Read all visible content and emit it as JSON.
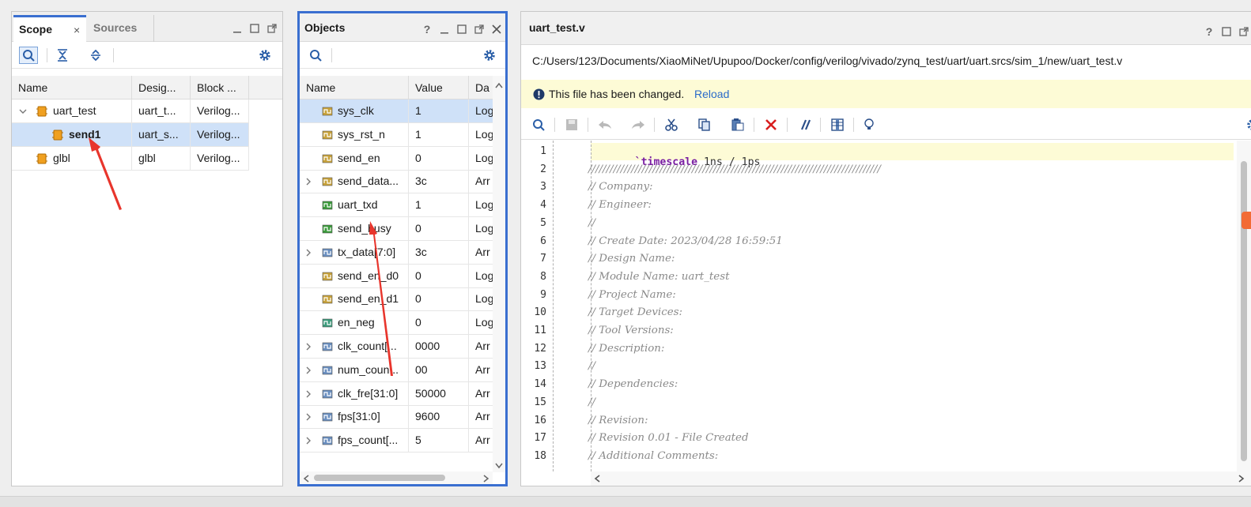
{
  "scope": {
    "tabs": [
      "Scope",
      "Sources"
    ],
    "columns": [
      "Name",
      "Desig...",
      "Block ..."
    ],
    "rows": [
      {
        "name": "uart_test",
        "design": "uart_t...",
        "block": "Verilog..."
      },
      {
        "name": "send1",
        "design": "uart_s...",
        "block": "Verilog..."
      },
      {
        "name": "glbl",
        "design": "glbl",
        "block": "Verilog..."
      }
    ]
  },
  "objects": {
    "title": "Objects",
    "columns": [
      "Name",
      "Value",
      "Da"
    ],
    "rows": [
      {
        "name": "sys_clk",
        "value": "1",
        "type": "Log"
      },
      {
        "name": "sys_rst_n",
        "value": "1",
        "type": "Log"
      },
      {
        "name": "send_en",
        "value": "0",
        "type": "Log"
      },
      {
        "name": "send_data...",
        "value": "3c",
        "type": "Arr"
      },
      {
        "name": "uart_txd",
        "value": "1",
        "type": "Log"
      },
      {
        "name": "send_busy",
        "value": "0",
        "type": "Log"
      },
      {
        "name": "tx_data[7:0]",
        "value": "3c",
        "type": "Arr"
      },
      {
        "name": "send_en_d0",
        "value": "0",
        "type": "Log"
      },
      {
        "name": "send_en_d1",
        "value": "0",
        "type": "Log"
      },
      {
        "name": "en_neg",
        "value": "0",
        "type": "Log"
      },
      {
        "name": "clk_count[...",
        "value": "0000",
        "type": "Arr"
      },
      {
        "name": "num_coun...",
        "value": "00",
        "type": "Arr"
      },
      {
        "name": "clk_fre[31:0]",
        "value": "50000",
        "type": "Arr"
      },
      {
        "name": "fps[31:0]",
        "value": "9600",
        "type": "Arr"
      },
      {
        "name": "fps_count[...",
        "value": "5",
        "type": "Arr"
      }
    ]
  },
  "editor": {
    "title": "uart_test.v",
    "path": "C:/Users/123/Documents/XiaoMiNet/Upupoo/Docker/config/verilog/vivado/zynq_test/uart/uart.srcs/sim_1/new/uart_test.v",
    "notice": "This file has been changed.",
    "reload": "Reload",
    "line_numbers": [
      "1",
      "2",
      "3",
      "4",
      "5",
      "6",
      "7",
      "8",
      "9",
      "10",
      "11",
      "12",
      "13",
      "14",
      "15",
      "16",
      "17",
      "18"
    ],
    "keyword": "`timescale",
    "line1_rest": " 1ns / 1ps",
    "lines": [
      "//////////////////////////////////////////////////////////////////////////////////",
      "// Company:",
      "// Engineer:",
      "//",
      "// Create Date: 2023/04/28 16:59:51",
      "// Design Name:",
      "// Module Name: uart_test",
      "// Project Name:",
      "// Target Devices:",
      "// Tool Versions:",
      "// Description:",
      "//",
      "// Dependencies:",
      "//",
      "// Revision:",
      "// Revision 0.01 - File Created",
      "// Additional Comments:"
    ]
  },
  "colors": {
    "accent": "#3a6fd0",
    "selection": "#cfe1f8",
    "notice_bg": "#fdfbd6",
    "annotation_arrow": "#e8352c",
    "keyword": "#7a1fa2"
  }
}
